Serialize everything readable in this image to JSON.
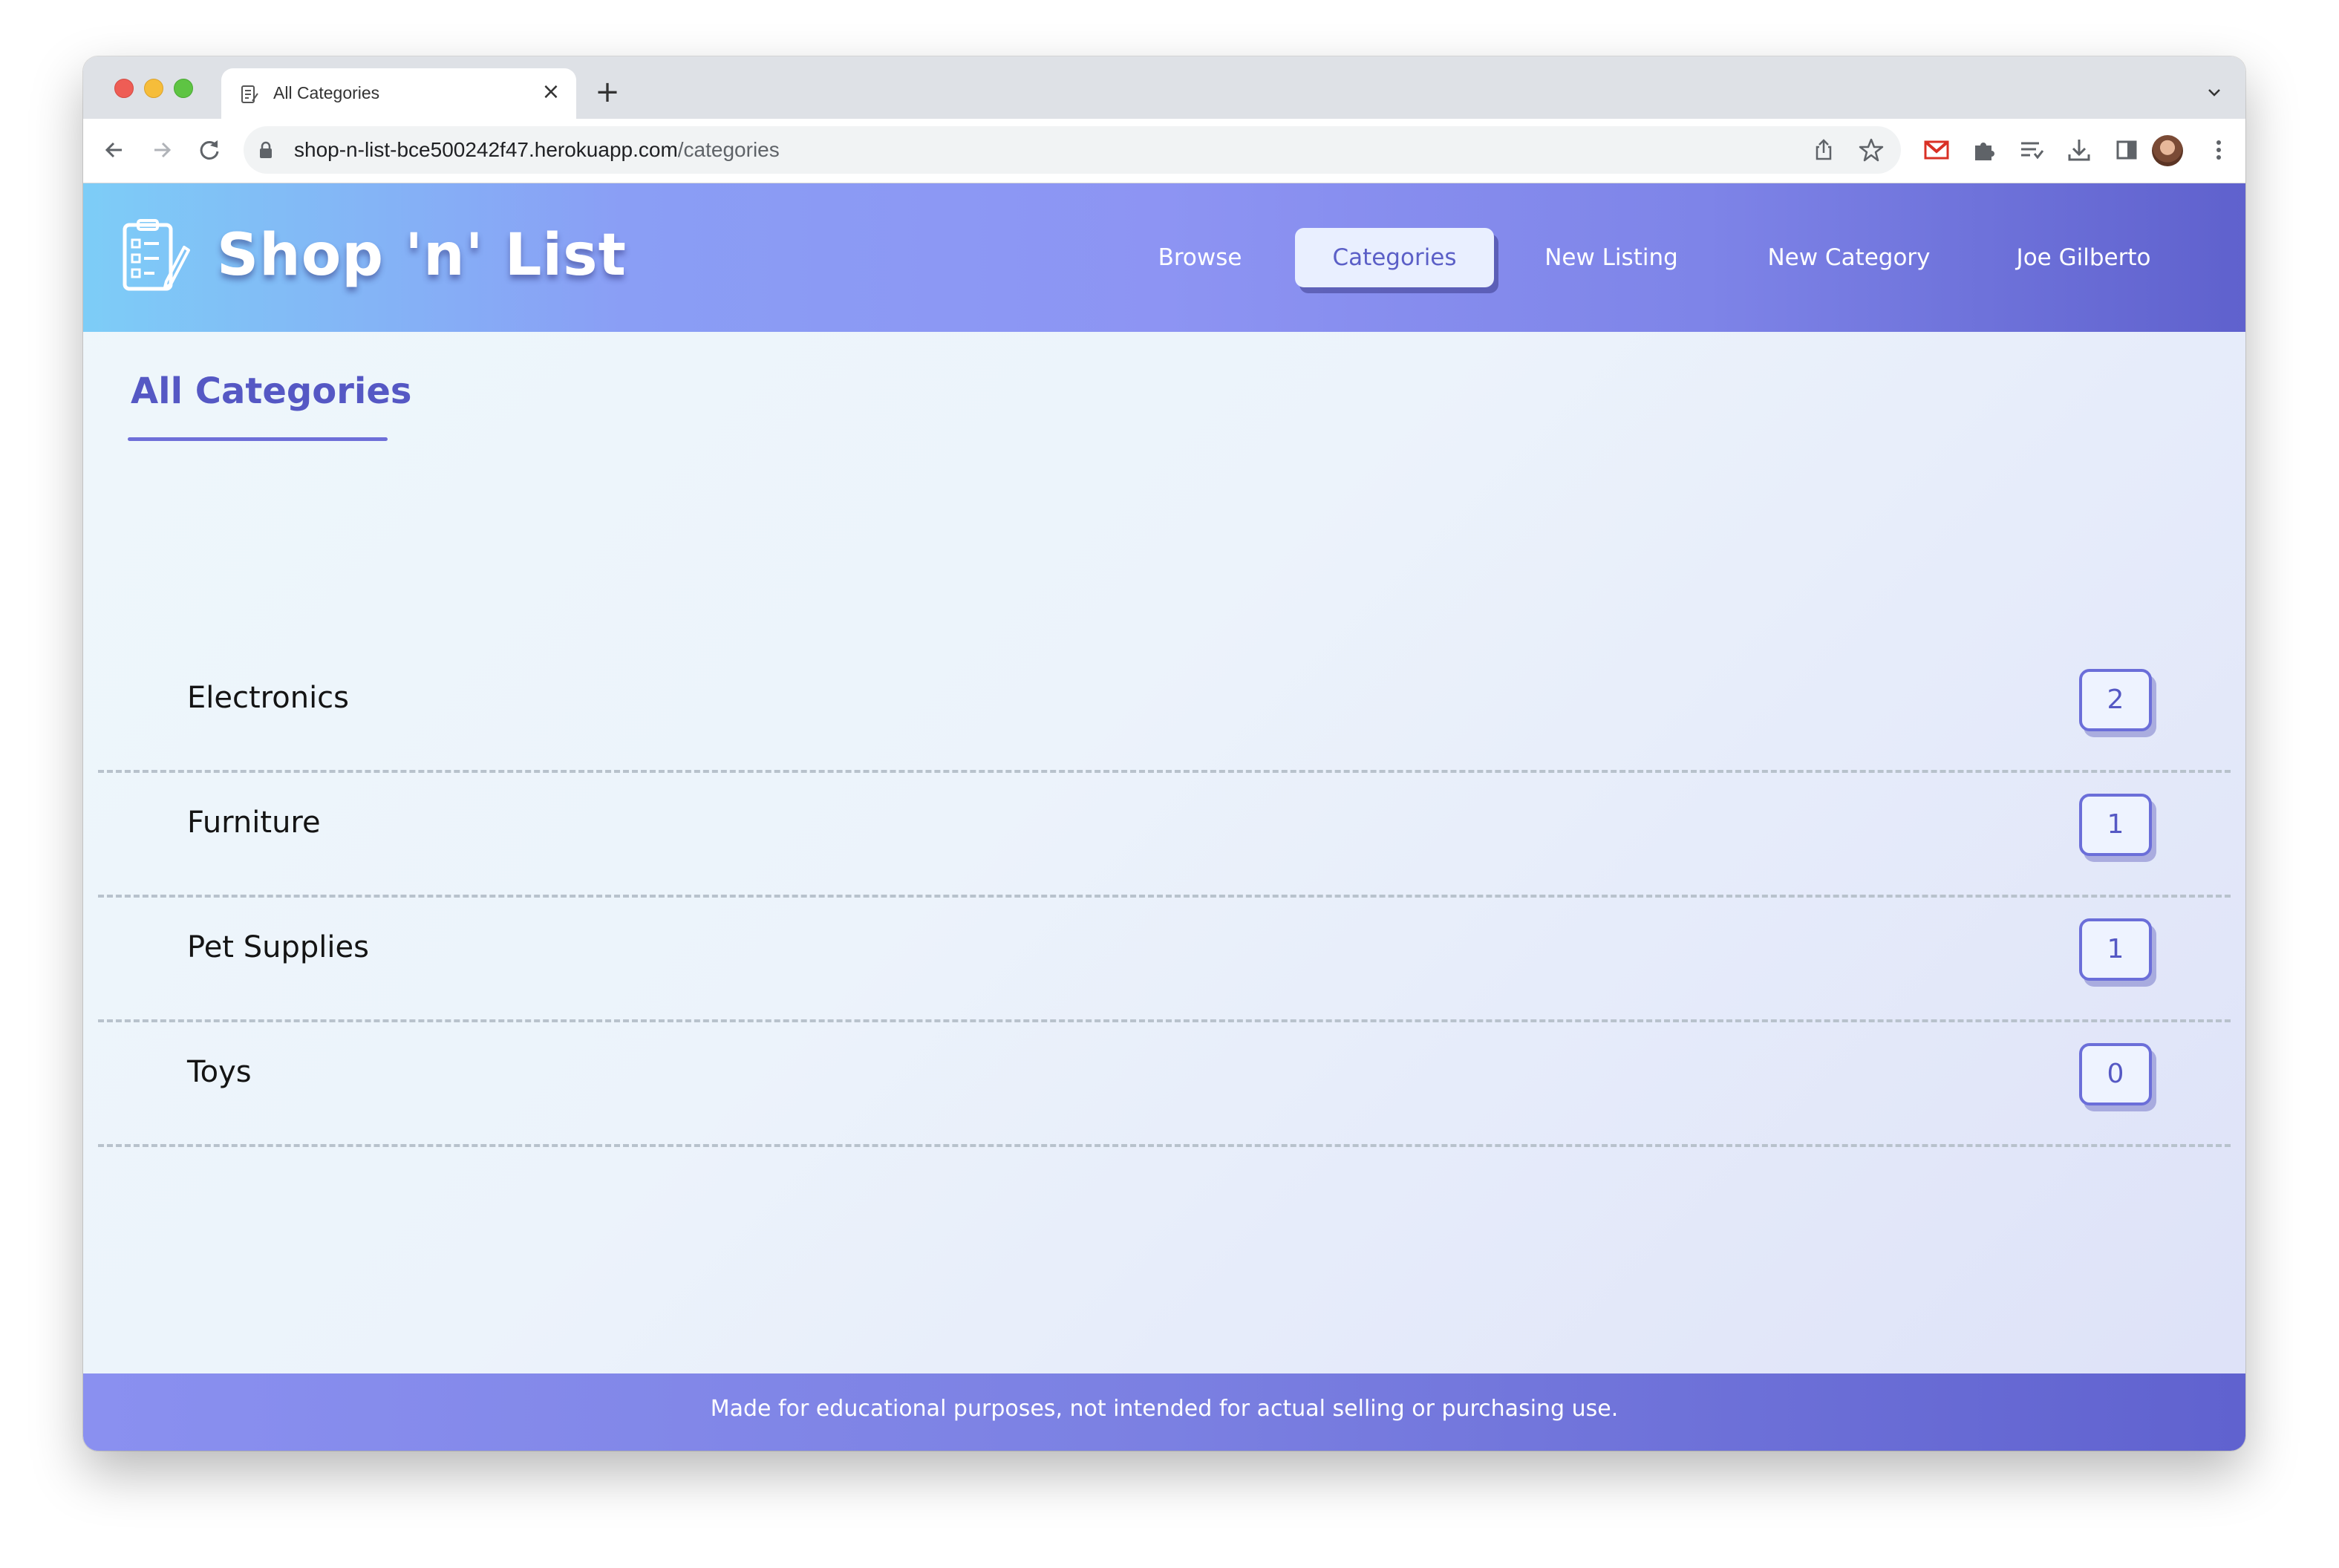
{
  "browser": {
    "tab_title": "All Categories",
    "new_tab_symbol": "+",
    "close_symbol": "×",
    "url_host": "shop-n-list-bce500242f47.herokuapp.com",
    "url_path": "/categories"
  },
  "navbar": {
    "brand": "Shop 'n' List",
    "links": [
      {
        "label": "Browse",
        "active": false
      },
      {
        "label": "Categories",
        "active": true
      },
      {
        "label": "New Listing",
        "active": false
      },
      {
        "label": "New Category",
        "active": false
      },
      {
        "label": "Joe Gilberto",
        "active": false
      }
    ]
  },
  "main": {
    "title": "All Categories",
    "categories": [
      {
        "name": "Electronics",
        "count": "2"
      },
      {
        "name": "Furniture",
        "count": "1"
      },
      {
        "name": "Pet Supplies",
        "count": "1"
      },
      {
        "name": "Toys",
        "count": "0"
      }
    ]
  },
  "footer": {
    "text": "Made for educational purposes, not intended for actual selling or purchasing use."
  },
  "colors": {
    "accent": "#5558c4",
    "navbar_start": "#7dcdf7",
    "navbar_end": "#5f61cd"
  },
  "icons": {
    "tab_favicon": "checklist-icon",
    "back": "arrow-left-icon",
    "forward": "arrow-right-icon",
    "reload": "reload-icon",
    "lock": "lock-icon",
    "share": "share-icon",
    "bookmark": "star-icon",
    "gmail": "gmail-icon",
    "extensions": "puzzle-icon",
    "reading_list": "reading-list-icon",
    "downloads": "download-icon",
    "side_panel": "side-panel-icon",
    "menu": "kebab-menu-icon",
    "logo": "checklist-pencil-icon"
  }
}
